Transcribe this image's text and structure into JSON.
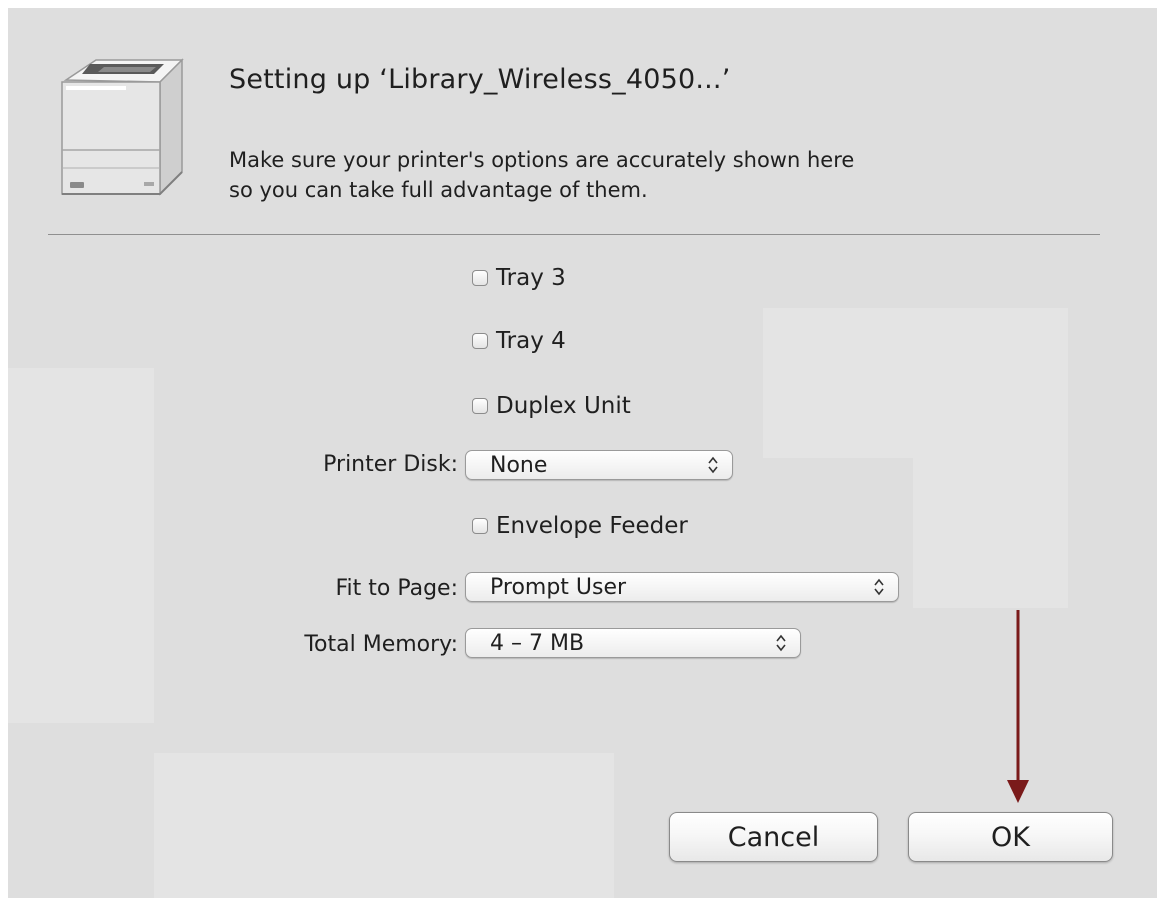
{
  "dialog": {
    "title": "Setting up ‘Library_Wireless_4050...’",
    "message_line1": "Make sure your printer's options are accurately shown here",
    "message_line2": "so you can take full advantage of them."
  },
  "options": {
    "tray3": {
      "label": "Tray 3",
      "checked": false
    },
    "tray4": {
      "label": "Tray 4",
      "checked": false
    },
    "duplex": {
      "label": "Duplex Unit",
      "checked": false
    },
    "printer_disk": {
      "label": "Printer Disk:",
      "value": "None"
    },
    "envelope": {
      "label": "Envelope Feeder",
      "checked": false
    },
    "fit_to_page": {
      "label": "Fit to Page:",
      "value": "Prompt User"
    },
    "total_memory": {
      "label": "Total Memory:",
      "value": "4 – 7 MB"
    }
  },
  "buttons": {
    "cancel": "Cancel",
    "ok": "OK"
  },
  "colors": {
    "dialog_background": "#dedede",
    "annotation_arrow": "#7a1a1a"
  },
  "icons": {
    "printer": "printer-icon",
    "chevron": "up-down-chevron-icon",
    "annotation": "arrow-down-icon"
  }
}
